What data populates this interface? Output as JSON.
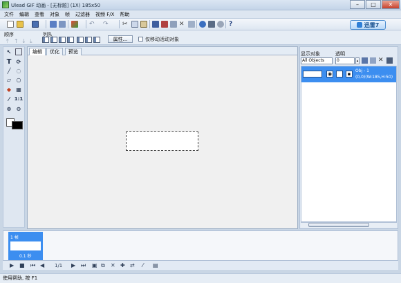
{
  "window": {
    "title": "Ulead GIF 动画 - [无标题] (1X) 185x50"
  },
  "menu": [
    "文件",
    "编辑",
    "查看",
    "对象",
    "帧",
    "过滤器",
    "视频 F/X",
    "帮助"
  ],
  "toolbar": {
    "xunlei_label": "迅雷7",
    "icons": [
      "new-icon",
      "open-icon",
      "save-icon",
      "export-icon",
      "preview-icon",
      "add-image-icon",
      "undo-icon",
      "redo-icon",
      "cut-icon",
      "copy-icon",
      "paste-icon",
      "frame-icon",
      "image-icon",
      "video-icon",
      "delete-icon",
      "text-icon",
      "optimize-icon",
      "globe-icon",
      "help-icon"
    ]
  },
  "toolbar2": {
    "order_label": "顺序",
    "arrange_label": "列队",
    "properties_label": "属性...",
    "only_move_label": "仅移动活动对象"
  },
  "canvas": {
    "tabs": [
      "编辑",
      "优化",
      "预览"
    ]
  },
  "right_panel": {
    "show_objects_label": "显示对象",
    "opacity_label": "透明",
    "objects_select": "All Objects",
    "opacity_value": "0",
    "object": {
      "name": "Obj - 1",
      "info": "(0,0)(W:185,H:50)"
    }
  },
  "frames": [
    {
      "label": "1 帧",
      "delay": "0.1 秒"
    }
  ],
  "playback": {
    "frame_counter": "1/1"
  },
  "status": {
    "text": "使用帮助, 按 F1"
  },
  "colors": {
    "selection_blue": "#3c8ef0",
    "fg": "#ffffff",
    "bg": "#000000"
  }
}
